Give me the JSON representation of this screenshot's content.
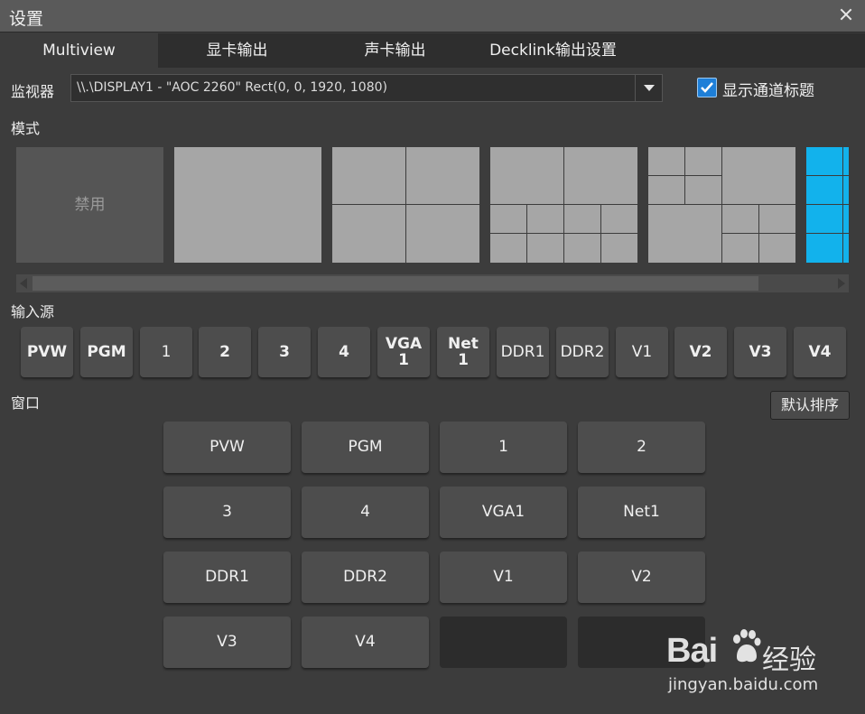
{
  "window": {
    "title": "设置",
    "close_icon": "close-icon"
  },
  "tabs": [
    {
      "label": "Multiview",
      "active": true
    },
    {
      "label": "显卡输出",
      "active": false
    },
    {
      "label": "声卡输出",
      "active": false
    },
    {
      "label": "Decklink输出设置",
      "active": false
    }
  ],
  "monitor": {
    "label": "监视器",
    "value": "\\\\.\\DISPLAY1 - \"AOC 2260\" Rect(0, 0, 1920, 1080)"
  },
  "show_channel_title": {
    "label": "显示通道标题",
    "checked": true
  },
  "mode": {
    "label": "模式",
    "disabled_label": "禁用"
  },
  "input_sources": {
    "label": "输入源",
    "buttons": [
      "PVW",
      "PGM",
      "1",
      "2",
      "3",
      "4",
      "VGA\n1",
      "Net\n1",
      "DDR1",
      "DDR2",
      "V1",
      "V2",
      "V3",
      "V4"
    ]
  },
  "window_section": {
    "label": "窗口",
    "default_sort_button": "默认排序",
    "grid": [
      "PVW",
      "PGM",
      "1",
      "2",
      "3",
      "4",
      "VGA1",
      "Net1",
      "DDR1",
      "DDR2",
      "V1",
      "V2",
      "V3",
      "V4",
      "",
      ""
    ]
  },
  "watermark": {
    "brand": "Bai",
    "brand_suffix": "经验",
    "url": "jingyan.baidu.com"
  },
  "colors": {
    "accent": "#12b2ec",
    "checkbox": "#1e7fd8"
  }
}
